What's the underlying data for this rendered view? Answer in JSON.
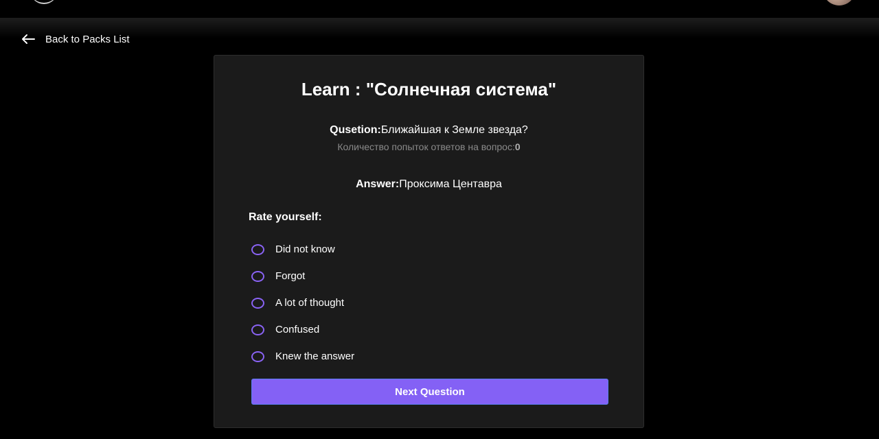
{
  "header": {
    "logo_icon": "logo-icon",
    "avatar_icon": "user-avatar"
  },
  "nav": {
    "back_icon": "arrow-left-icon",
    "back_label": "Back to Packs List"
  },
  "learn": {
    "title": "Learn : \"Солнечная система\"",
    "question_label": "Qusetion:",
    "question_text": "Ближайшая к Земле звезда?",
    "attempts_label": "Количество попыток ответов на вопрос:",
    "attempts_count": "0",
    "answer_label": "Answer:",
    "answer_text": "Проксима Центавра",
    "rate_label": "Rate yourself:",
    "options": [
      {
        "label": "Did not know"
      },
      {
        "label": "Forgot"
      },
      {
        "label": "A lot of thought"
      },
      {
        "label": "Confused"
      },
      {
        "label": "Knew the answer"
      }
    ],
    "next_button_label": "Next Question"
  },
  "colors": {
    "background": "#000000",
    "card": "#1b1b1b",
    "accent": "#8461f5",
    "muted_text": "#8a8a8a"
  }
}
